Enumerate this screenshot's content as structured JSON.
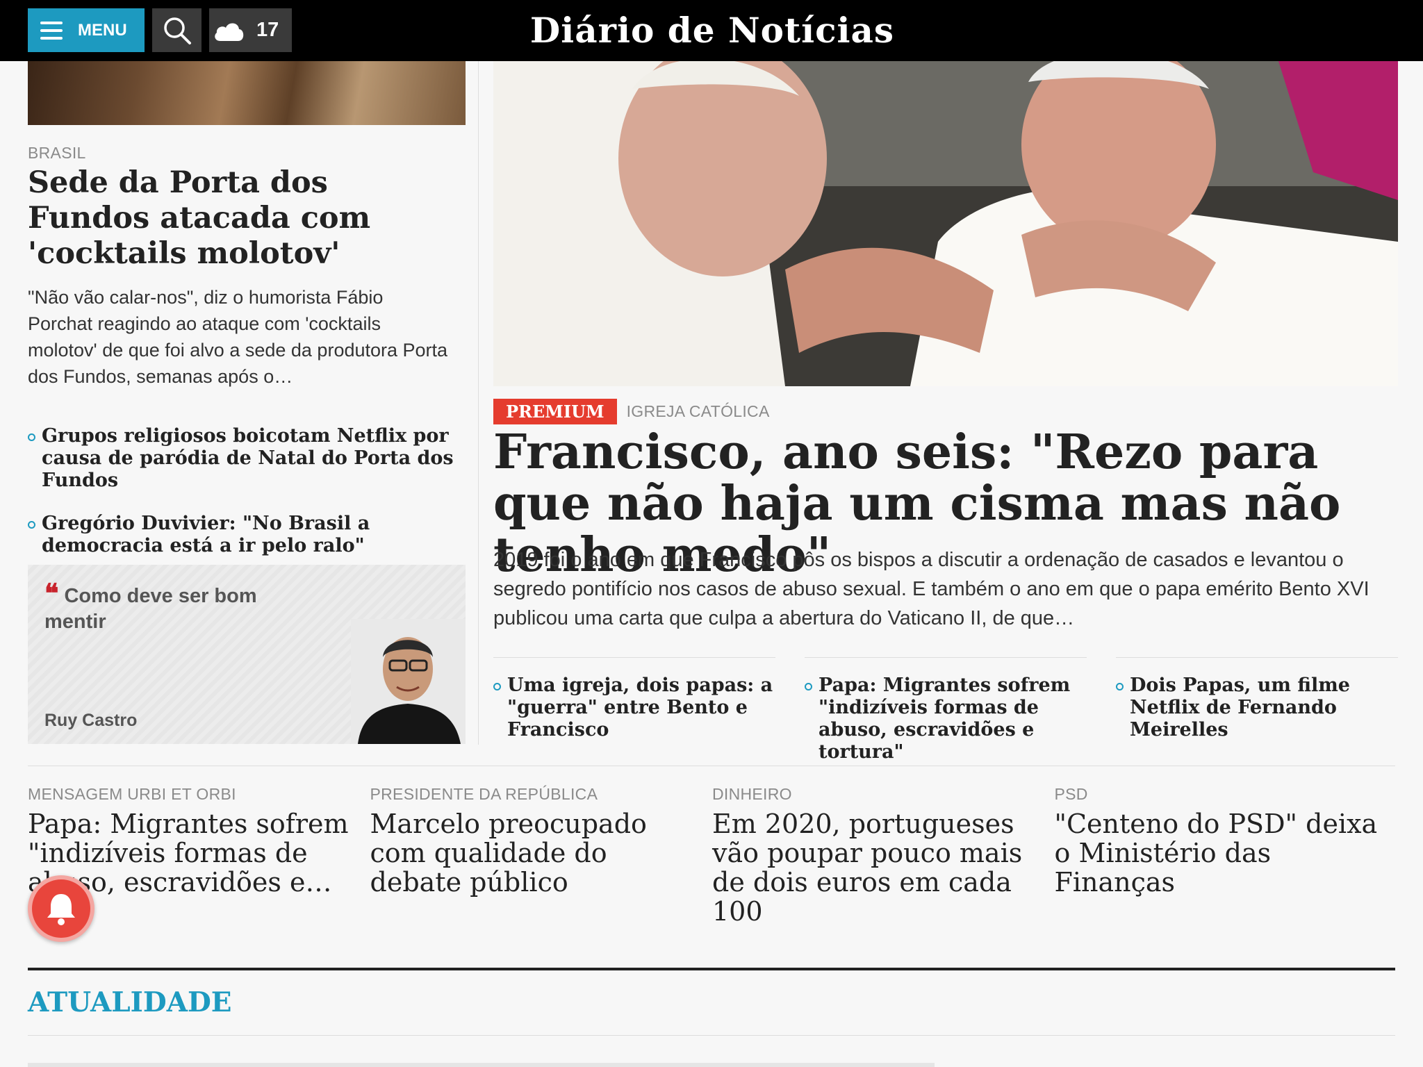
{
  "header": {
    "menu_label": "MENU",
    "temperature": "17",
    "logo_text": "Diário de Notícias"
  },
  "left_story": {
    "section": "BRASIL",
    "headline": "Sede da Porta dos Fundos atacada com 'cocktails molotov'",
    "lead": "\"Não vão calar-nos\", diz o humorista Fábio Porchat reagindo ao ataque com 'cocktails molotov' de que foi alvo a sede da produtora Porta dos Fundos, semanas após o…",
    "related": [
      "Grupos religiosos boicotam Netflix por causa de paródia de Natal do Porta dos Fundos",
      "Gregório Duvivier: \"No Brasil a democracia está a ir pelo ralo\""
    ]
  },
  "opinion": {
    "quote": "Como deve ser bom mentir",
    "author": "Ruy Castro"
  },
  "main_story": {
    "badge": "PREMIUM",
    "section": "IGREJA CATÓLICA",
    "headline": "Francisco, ano seis: \"Rezo para que não haja um cisma mas não tenho medo\"",
    "lead": "2019 foi o ano em que Francisco pôs os bispos a discutir a ordenação de casados e levantou o segredo pontifício nos casos de abuso sexual. E também o ano em que o papa emérito Bento XVI publicou uma carta que culpa a abertura do Vaticano II, de que…",
    "related": [
      "Uma igreja, dois papas: a \"guerra\" entre Bento e Francisco",
      "Papa: Migrantes sofrem \"indizíveis formas de abuso, escravidões e tortura\"",
      "Dois Papas, um filme Netflix de Fernando Meirelles"
    ]
  },
  "row_stories": [
    {
      "section": "MENSAGEM URBI ET ORBI",
      "title": "Papa: Migrantes sofrem \"indizíveis formas de abuso, escravidões e…"
    },
    {
      "section": "PRESIDENTE DA REPÚBLICA",
      "title": "Marcelo preocupado com qualidade do debate público"
    },
    {
      "section": "DINHEIRO",
      "title": "Em 2020, portugueses vão poupar pouco mais de dois euros em cada 100"
    },
    {
      "section": "PSD",
      "title": "\"Centeno do PSD\" deixa o Ministério das Finanças"
    }
  ],
  "section_heading": "ATUALIDADE",
  "colors": {
    "accent": "#1d9ac0",
    "premium": "#e53c2e",
    "header_bg": "#000000",
    "notification": "#e8453c"
  },
  "icons": {
    "menu": "hamburger-icon",
    "search": "search-icon",
    "weather": "cloud-icon",
    "notification": "bell-icon",
    "quote": "quote-icon"
  }
}
